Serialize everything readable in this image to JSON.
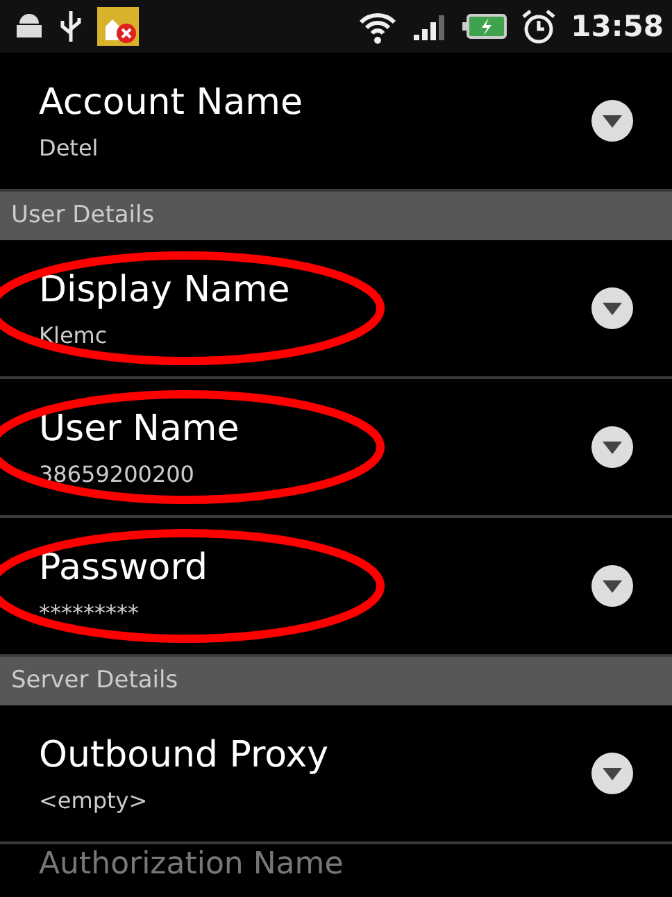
{
  "status_bar": {
    "time": "13:58"
  },
  "sections": [
    {
      "items": [
        {
          "title": "Account Name",
          "value": "Detel",
          "circled": false
        }
      ]
    },
    {
      "header": "User Details",
      "items": [
        {
          "title": "Display Name",
          "value": "Klemc",
          "circled": true
        },
        {
          "title": "User Name",
          "value": "38659200200",
          "circled": true
        },
        {
          "title": "Password",
          "value": "*********",
          "circled": true
        }
      ]
    },
    {
      "header": "Server Details",
      "items": [
        {
          "title": "Outbound Proxy",
          "value": "<empty>",
          "circled": false
        },
        {
          "title": "Authorization Name",
          "circled": false
        }
      ]
    }
  ]
}
